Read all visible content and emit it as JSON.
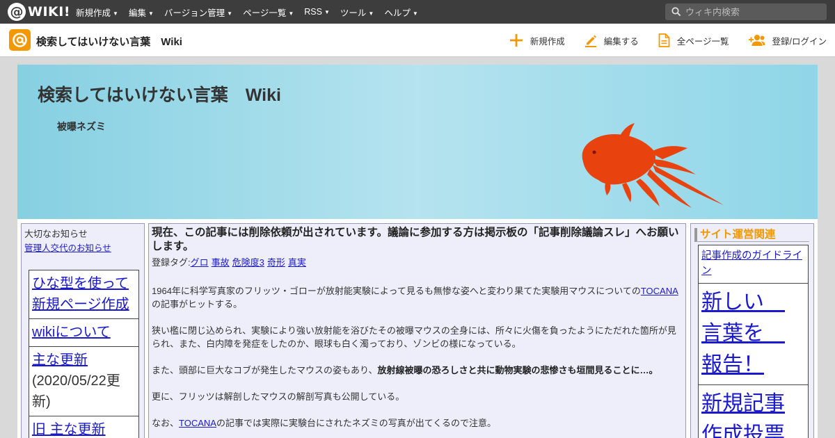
{
  "topbar": {
    "logo_at": "@",
    "logo_text": "WIKI!",
    "nav": [
      {
        "label": "新規作成"
      },
      {
        "label": "編集"
      },
      {
        "label": "バージョン管理"
      },
      {
        "label": "ページ一覧"
      },
      {
        "label": "RSS"
      },
      {
        "label": "ツール"
      },
      {
        "label": "ヘルプ"
      }
    ],
    "search_placeholder": "ウィキ内検索",
    "search_icon": "search-icon"
  },
  "subheader": {
    "site_title": "検索してはいけない言葉　Wiki",
    "actions": [
      {
        "label": "新規作成",
        "icon": "plus-icon"
      },
      {
        "label": "編集する",
        "icon": "pencil-icon"
      },
      {
        "label": "全ページ一覧",
        "icon": "document-icon"
      },
      {
        "label": "登録/ログイン",
        "icon": "add-user-icon"
      }
    ]
  },
  "banner": {
    "title": "検索してはいけない言葉　Wiki",
    "subtitle": "被曝ネズミ"
  },
  "left": {
    "notice_label": "大切なお知らせ",
    "notice_link": "管理人交代のお知らせ",
    "menu": [
      {
        "label": "ひな型を使って新規ページ作成"
      },
      {
        "label": "wikiについて"
      },
      {
        "label": "主な更新",
        "note": "(2020/05/22更新)"
      },
      {
        "label": "旧 主な更新"
      }
    ]
  },
  "main": {
    "notice": "現在、この記事には削除依頼が出されています。議論に参加する方は掲示板の「記事削除議論スレ」へお願いします。",
    "tags_label": "登録タグ:",
    "tags": [
      "グロ",
      "事故",
      "危険度3",
      "奇形",
      "真実"
    ],
    "p1_before": "1964年に科学写真家のフリッツ・ゴローが放射能実験によって見るも無惨な姿へと変わり果てた実験用マウスについての",
    "p1_link": "TOCANA",
    "p1_after": "の記事がヒットする。",
    "p2": "狭い檻に閉じ込められ、実験により強い放射能を浴びたその被曝マウスの全身には、所々に火傷を負ったようにただれた箇所が見られ、また、白内障を発症をしたのか、眼球も白く濁っており、ゾンビの様になっている。",
    "p3_before": "また、頭部に巨大なコブが発生したマウスの姿もあり、",
    "p3_bold": "放射線被曝の恐ろしさと共に動物実験の悲惨さも垣間見ることに…。",
    "p4": "更に、フリッツは解剖したマウスの解剖写真も公開している。",
    "p5_before": "なお、",
    "p5_link": "TOCANA",
    "p5_after": "の記事では実際に実験台にされたネズミの写真が出てくるので注意。"
  },
  "right": {
    "heading": "サイト運営関連",
    "menu": [
      {
        "label": "記事作成のガイドライン"
      },
      {
        "label": "新しい　言葉を　報告！"
      },
      {
        "label": "新規記事作成投票"
      }
    ]
  },
  "colors": {
    "topbar_bg": "#3d3d3d",
    "accent_orange": "#f39800",
    "link_blue": "#1a1acc",
    "goldfish": "#e8420f",
    "panel_bg": "#eeeefa"
  }
}
